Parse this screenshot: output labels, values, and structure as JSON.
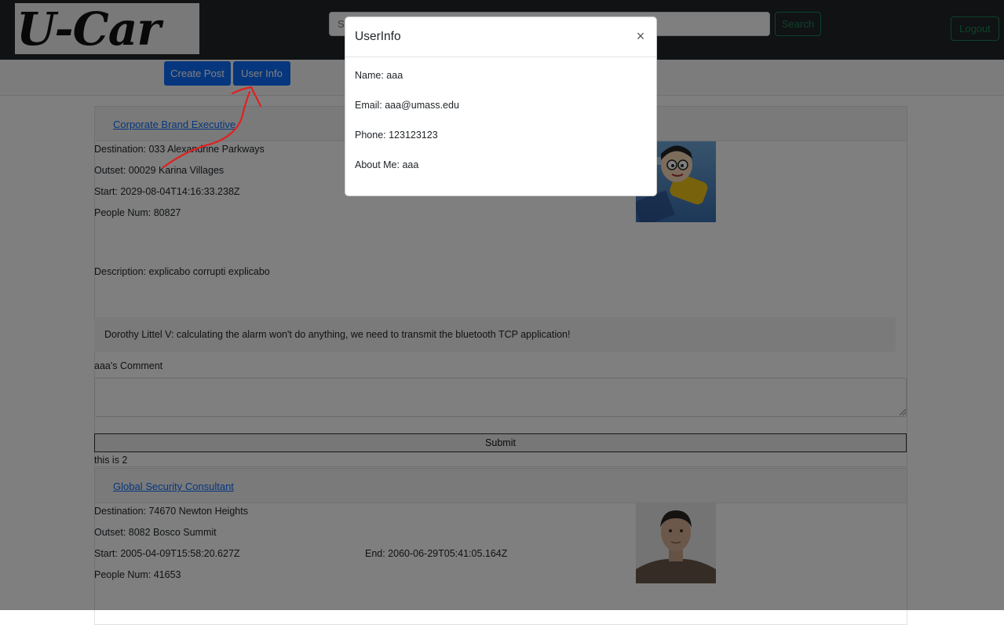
{
  "navbar": {
    "logo_text": "U-Car",
    "search_placeholder": "Search",
    "search_button": "Search",
    "logout_button": "Logout"
  },
  "subnav": {
    "create_post": "Create Post",
    "user_info": "User Info"
  },
  "posts": [
    {
      "title": "Corporate Brand Executive",
      "destination": "Destination: 033 Alexandrine Parkways",
      "outset": "Outset: 00029 Karina Villages",
      "start": "Start: 2029-08-04T14:16:33.238Z",
      "people": "People Num: 80827",
      "description": "Description: explicabo corrupti explicabo",
      "comment": "Dorothy Littel V: calculating the alarm won't do anything, we need to transmit the bluetooth TCP application!",
      "comment_label": "aaa's Comment",
      "submit": "Submit",
      "footer_text": "this is 2"
    },
    {
      "title": "Global Security Consultant",
      "destination": "Destination: 74670 Newton Heights",
      "outset": "Outset: 8082 Bosco Summit",
      "start": "Start: 2005-04-09T15:58:20.627Z",
      "end": "End: 2060-06-29T05:41:05.164Z",
      "people": "People Num: 41653"
    }
  ],
  "modal": {
    "title": "UserInfo",
    "close": "×",
    "name": "Name: aaa",
    "email": "Email: aaa@umass.edu",
    "phone": "Phone: 123123123",
    "about": "About Me: aaa"
  },
  "colors": {
    "navbar": "#212529",
    "primary": "#0d6efd",
    "success": "#198754",
    "annotation": "#e02020"
  }
}
